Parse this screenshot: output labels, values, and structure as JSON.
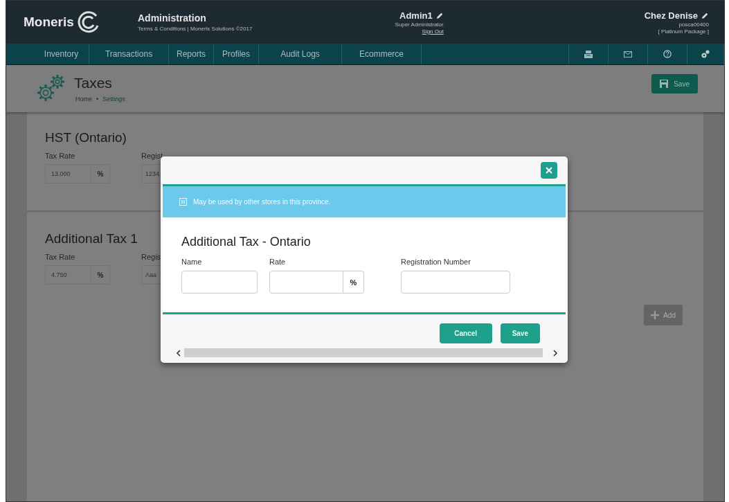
{
  "header": {
    "logo": "Moneris",
    "app_title": "Administration",
    "app_subtitle": "Terms & Conditions | Moneris Solutions ©2017",
    "user": {
      "name": "Admin1",
      "role": "Super Administrator",
      "sign_out": "Sign Out"
    },
    "store": {
      "name": "Chez Denise",
      "id": "posca00400",
      "package": "[ Platinum Package ]"
    }
  },
  "nav": {
    "items": [
      "Inventory",
      "Transactions",
      "Reports",
      "Profiles",
      "Audit Logs",
      "Ecommerce"
    ]
  },
  "page": {
    "title": "Taxes",
    "breadcrumb": [
      "Home",
      "Settings"
    ],
    "breadcrumb_separator": "•",
    "save": "Save"
  },
  "sections": [
    {
      "title": "HST (Ontario)",
      "rate_label": "Tax Rate",
      "rate": "13.000",
      "unit": "%",
      "reg_label": "Regist",
      "reg_value": "1234"
    },
    {
      "title": "Additional Tax 1",
      "rate_label": "Tax Rate",
      "rate": "4.750",
      "unit": "%",
      "reg_label": "Regis",
      "reg_value": "Aaa"
    }
  ],
  "add_button": "Add",
  "dialog": {
    "notice": "May be used by other stores in this province.",
    "title": "Additional Tax - Ontario",
    "fields": [
      {
        "label": "Name",
        "kind": "text"
      },
      {
        "label": "Rate",
        "kind": "percent",
        "unit": "%"
      },
      {
        "label": "Registration Number",
        "kind": "text"
      }
    ],
    "buttons": [
      "Cancel",
      "Save"
    ]
  }
}
